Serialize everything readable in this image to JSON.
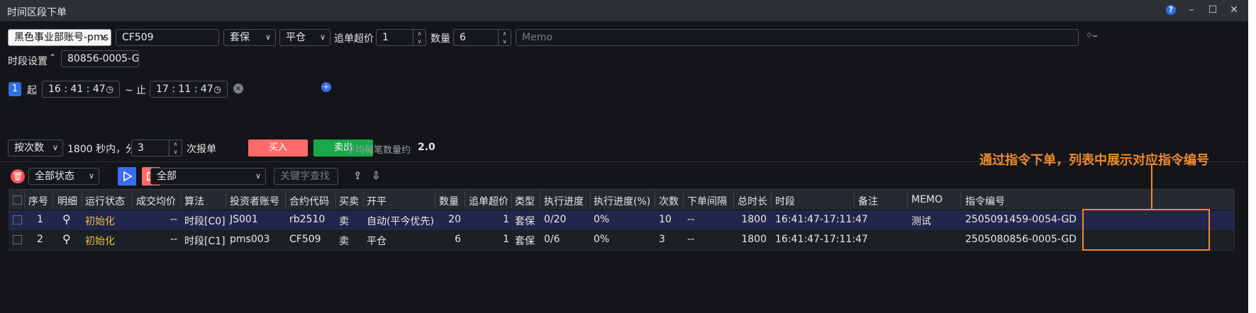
{
  "window": {
    "title": "时间区段下单",
    "help": "?"
  },
  "form": {
    "account": "黑色事业部账号-pms",
    "contract": "CF509",
    "hedge": "套保",
    "offset": "平仓",
    "chase_label": "追单超价",
    "chase_value": "1",
    "qty_label": "数量",
    "qty_value": "6",
    "memo_placeholder": "Memo"
  },
  "period": {
    "label": "时段设置",
    "code": "80856-0005-GD",
    "index": "1",
    "start_label": "起",
    "start_time": "16 : 41 : 47",
    "end_label": "~ 止",
    "end_time": "17 : 11 : 47"
  },
  "order": {
    "mode": "按次数",
    "seconds_text": "1800 秒内，分",
    "count": "3",
    "unit": "次报单",
    "buy": "买入",
    "sell": "卖出",
    "avg_label": "平均每笔数量约",
    "avg_value": "2.0"
  },
  "list_toolbar": {
    "status_filter": "全部状态",
    "type_filter": "全部",
    "search_placeholder": "关键字查找"
  },
  "table": {
    "headers": [
      "序号",
      "明细",
      "运行状态",
      "成交均价",
      "算法",
      "投资者账号",
      "合约代码",
      "买卖",
      "开平",
      "数量",
      "追单超价",
      "类型",
      "执行进度",
      "执行进度(%)",
      "次数",
      "下单间隔",
      "总时长",
      "时段",
      "备注",
      "MEMO",
      "指令编号"
    ],
    "rows": [
      {
        "no": "1",
        "status": "初始化",
        "avg": "--",
        "algo": "时段[C0]",
        "account": "JS001",
        "contract": "rb2510",
        "side": "卖",
        "offset": "自动(平今优先)",
        "qty": "20",
        "chase": "1",
        "type": "套保",
        "progress": "0/20",
        "pct": "0%",
        "times": "10",
        "interval": "--",
        "duration": "1800",
        "period": "16:41:47-17:11:47",
        "note": "",
        "memo": "测试",
        "cmd": "2505091459-0054-GD"
      },
      {
        "no": "2",
        "status": "初始化",
        "avg": "--",
        "algo": "时段[C1]",
        "account": "pms003",
        "contract": "CF509",
        "side": "卖",
        "offset": "平仓",
        "qty": "6",
        "chase": "1",
        "type": "套保",
        "progress": "0/6",
        "pct": "0%",
        "times": "3",
        "interval": "--",
        "duration": "1800",
        "period": "16:41:47-17:11:47",
        "note": "",
        "memo": "",
        "cmd": "2505080856-0005-GD"
      }
    ]
  },
  "annotation": {
    "text": "通过指令下单，列表中展示对应指令编号"
  },
  "colors": {
    "buy": "#ff6b6b",
    "sell": "#1aa84a",
    "accent": "#3b6df2",
    "annotation": "#f08a2e",
    "status": "#e6c34a"
  }
}
